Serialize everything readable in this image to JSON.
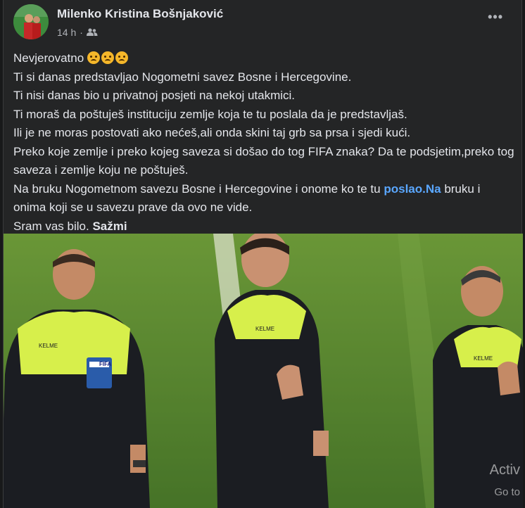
{
  "post": {
    "author": "Milenko Kristina Bošnjaković",
    "time": "14 h",
    "separator": "·",
    "audience_icon": "friends-icon",
    "menu_icon": "more-dots-icon",
    "more_label": "•••",
    "lines": {
      "l1": "Nevjerovatno",
      "l2": "Ti si danas predstavljao Nogometni savez Bosne i Hercegovine.",
      "l3": "Ti nisi danas bio u privatnoj posjeti na nekoj utakmici.",
      "l4": "Ti moraš da poštuješ instituciju zemlje koja te tu poslala da je predstavljaš.",
      "l5": "Ili je ne moras postovati ako nećeš,ali onda skini taj grb sa prsa i sjedi kući.",
      "l6": "Preko koje zemlje i preko kojeg saveza si došao do tog FIFA znaka? Da te podsjetim,preko tog saveza i zemlje koju ne poštuješ.",
      "l7": "Na bruku Nogometnom savezu Bosne i Hercegovine i onome ko te tu ",
      "l7_link": "poslao.Na",
      "l8": " bruku i onima koji se u savezu prave da ovo ne vide.",
      "l9": "Sram vas bilo.",
      "see_more": "Sažmi"
    },
    "photo": {
      "badge_fifa": "FIFA",
      "kit_text_1": "KELME",
      "kit_text_2": "KELME",
      "kit_text_3": "KELME"
    },
    "overlay": {
      "line1": "Activ",
      "line2": "Go to"
    }
  }
}
